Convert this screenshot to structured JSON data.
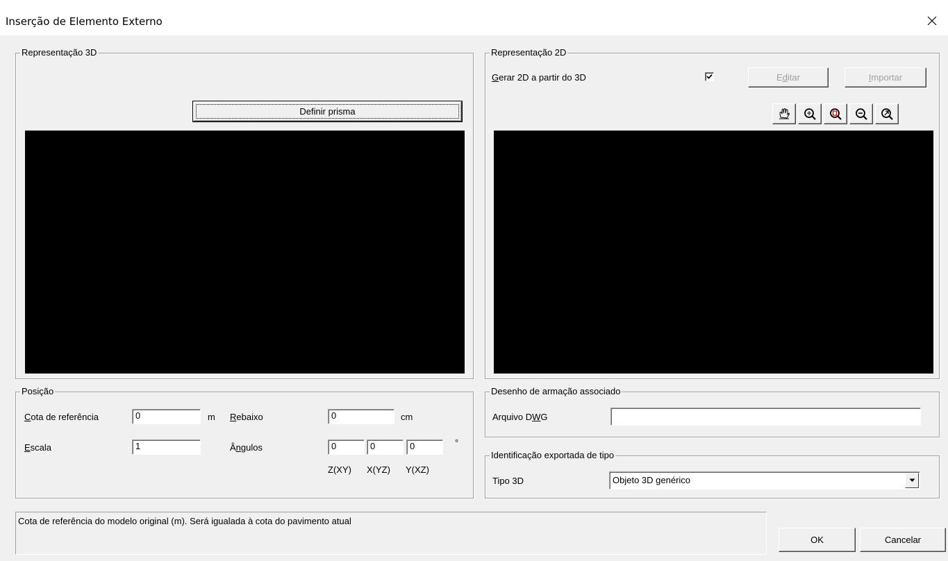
{
  "window": {
    "title": "Inserção de Elemento Externo",
    "close_icon": "close-icon"
  },
  "rep3d": {
    "legend": "Representação 3D",
    "define_prism_label": "Definir prisma"
  },
  "rep2d": {
    "legend": "Representação 2D",
    "generate_label_pre": "",
    "generate_label_u": "G",
    "generate_label_post": "erar 2D a partir do 3D",
    "generate_checked": true,
    "edit_label_pre": "E",
    "edit_label_u": "d",
    "edit_label_post": "itar",
    "import_label_u": "I",
    "import_label_post": "mportar",
    "tools": [
      "pan-icon",
      "zoom-window-icon",
      "zoom-all-icon",
      "zoom-out-icon",
      "zoom-previous-icon"
    ]
  },
  "position": {
    "legend": "Posição",
    "cota_label_u": "C",
    "cota_label_post": "ota de referência",
    "cota_value": "0",
    "cota_unit": "m",
    "rebaixo_label_u": "R",
    "rebaixo_label_post": "ebaixo",
    "rebaixo_value": "0",
    "rebaixo_unit": "cm",
    "escala_label_u": "E",
    "escala_label_post": "scala",
    "escala_value": "1",
    "angulos_label_pre": "Â",
    "angulos_label_u": "n",
    "angulos_label_post": "gulos",
    "angle_z": "0",
    "angle_x": "0",
    "angle_y": "0",
    "angle_unit": "°",
    "angle_z_caption": "Z(XY)",
    "angle_x_caption": "X(YZ)",
    "angle_y_caption": "Y(XZ)"
  },
  "drawing": {
    "legend": "Desenho de armação associado",
    "dwg_label_pre": "Arquivo D",
    "dwg_label_u": "W",
    "dwg_label_post": "G",
    "dwg_value": ""
  },
  "identification": {
    "legend": "Identificação exportada de tipo",
    "tipo_label": "Tipo 3D",
    "tipo_value": "Objeto 3D genérico"
  },
  "status": {
    "message": "Cota de referência do modelo original (m). Será igualada à cota do pavimento atual"
  },
  "footer": {
    "ok_label": "OK",
    "cancel_label": "Cancelar"
  }
}
